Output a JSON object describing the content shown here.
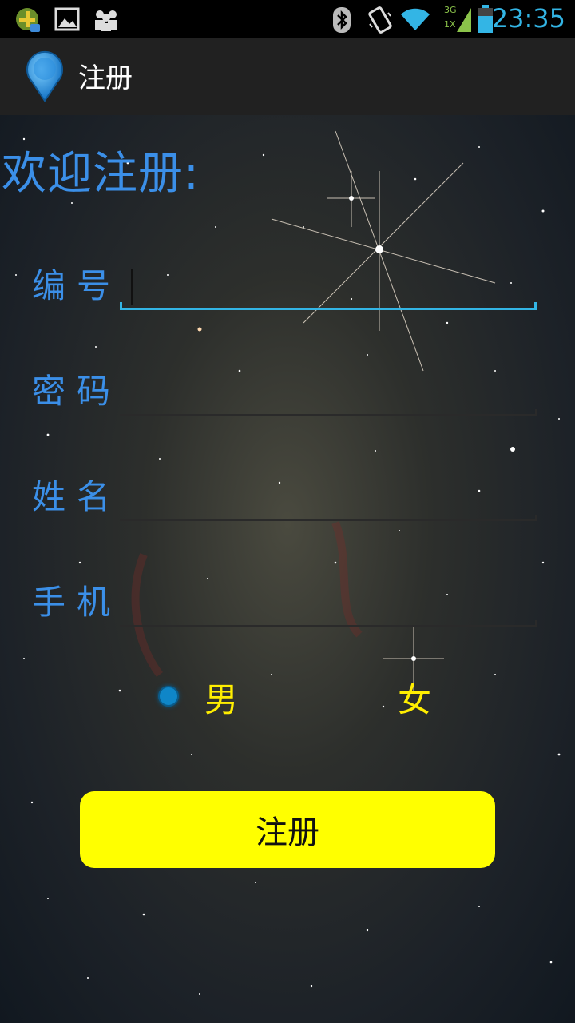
{
  "status_bar": {
    "time": "23:35",
    "network": "3G",
    "network_sub": "1X",
    "icons": [
      "app-plus-icon",
      "image-icon",
      "people-icon",
      "bluetooth-icon",
      "vibrate-icon",
      "wifi-icon",
      "signal-icon",
      "battery-icon"
    ]
  },
  "action_bar": {
    "title": "注册",
    "icon": "location-pin-icon"
  },
  "form": {
    "welcome": "欢迎注册:",
    "fields": [
      {
        "label": "编号",
        "value": ""
      },
      {
        "label": "密码",
        "value": ""
      },
      {
        "label": "姓名",
        "value": ""
      },
      {
        "label": "手机",
        "value": ""
      }
    ],
    "gender": {
      "options": [
        "男",
        "女"
      ],
      "selected": "男"
    },
    "submit_label": "注册"
  },
  "colors": {
    "accent": "#33b5e5",
    "label": "#3b8fe8",
    "radio_label": "#ffee00",
    "button": "#ffff00"
  }
}
